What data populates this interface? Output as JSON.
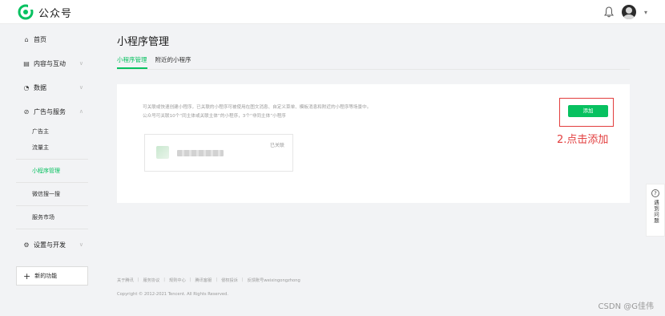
{
  "header": {
    "app_name": "公众号",
    "brand_color": "#07c160"
  },
  "sidebar": {
    "items": [
      {
        "label": "首页",
        "icon": "home-icon"
      },
      {
        "label": "内容与互动",
        "icon": "document-icon"
      },
      {
        "label": "数据",
        "icon": "pie-chart-icon"
      },
      {
        "label": "广告与服务",
        "icon": "ad-icon"
      }
    ],
    "sub_items": [
      "广告主",
      "流量主",
      "小程序管理",
      "微信搜一搜",
      "服务市场"
    ],
    "settings_label": "设置与开发",
    "new_feature_label": "新的功能"
  },
  "main": {
    "title": "小程序管理",
    "tabs": [
      {
        "label": "小程序管理",
        "active": true
      },
      {
        "label": "附近的小程序",
        "active": false
      }
    ],
    "description_line1": "可关联或快速创建小程序，已关联的小程序可被使用在图文消息、自定义菜单、模板消息和附近的小程序等场景中。",
    "description_line2": "公众号可关联10个“同主体或关联主体”的小程序，3个“非同主体”小程序",
    "add_button": "添加",
    "annotation": "2.点击添加",
    "mini_program_status": "已关联"
  },
  "help": {
    "label": "遇到问题"
  },
  "footer": {
    "links": [
      "关于腾讯",
      "服务协议",
      "规则中心",
      "腾讯客服",
      "侵权投诉",
      "反馈账号weixingongzhong"
    ],
    "copyright": "Copyright © 2012-2021 Tencent. All Rights Reserved."
  },
  "watermark": "CSDN @G佳伟"
}
